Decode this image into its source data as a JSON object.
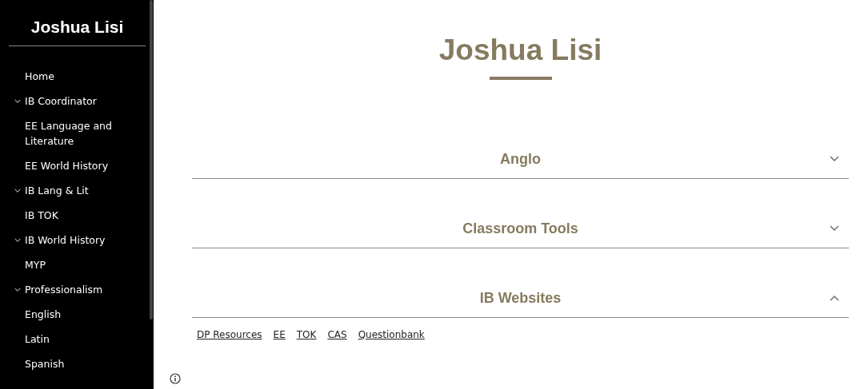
{
  "sidebar": {
    "title": "Joshua Lisi",
    "items": [
      {
        "label": "Home",
        "kind": "page"
      },
      {
        "label": "IB Coordinator",
        "kind": "group",
        "expanded": true
      },
      {
        "label": "EE Language and Literature",
        "kind": "page"
      },
      {
        "label": "EE World History",
        "kind": "page"
      },
      {
        "label": "IB Lang & Lit",
        "kind": "group",
        "expanded": true
      },
      {
        "label": "IB TOK",
        "kind": "page"
      },
      {
        "label": "IB World History",
        "kind": "group",
        "expanded": true
      },
      {
        "label": "MYP",
        "kind": "page"
      },
      {
        "label": "Professionalism",
        "kind": "group",
        "expanded": true
      },
      {
        "label": "English",
        "kind": "page"
      },
      {
        "label": "Latin",
        "kind": "page"
      },
      {
        "label": "Spanish",
        "kind": "page"
      }
    ]
  },
  "page": {
    "title": "Joshua Lisi",
    "sections": [
      {
        "heading": "Anglo",
        "expanded": false
      },
      {
        "heading": "Classroom Tools",
        "expanded": false
      },
      {
        "heading": "IB Websites",
        "expanded": true,
        "links": [
          "DP Resources",
          "EE",
          "TOK",
          "CAS",
          "Questionbank"
        ]
      }
    ]
  }
}
